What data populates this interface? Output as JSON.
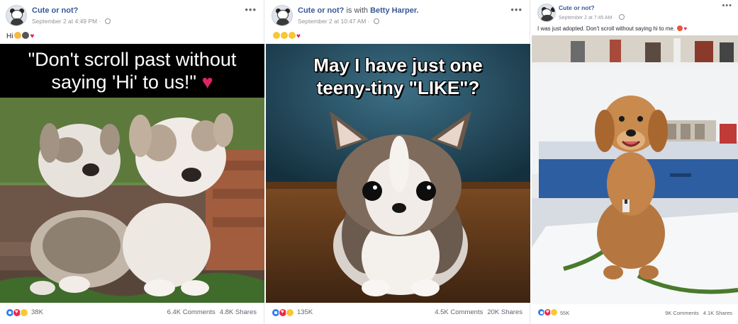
{
  "posts": [
    {
      "page_name": "Cute or not?",
      "with_text": "",
      "with_person": "",
      "timestamp": "September 2 at 4:49 PM",
      "caption": "Hi",
      "image_text_line1": "\"Don't scroll past without",
      "image_text_line2": "saying 'Hi' to us!\"",
      "reaction_count": "38K",
      "comments": "6.4K Comments",
      "shares": "4.8K Shares"
    },
    {
      "page_name": "Cute or not?",
      "with_text": " is with ",
      "with_person": "Betty Harper.",
      "timestamp": "September 2 at 10:47 AM",
      "caption": "",
      "image_text_line1": "May I have just one",
      "image_text_line2": "teeny-tiny \"LIKE\"?",
      "reaction_count": "135K",
      "comments": "4.5K Comments",
      "shares": "20K Shares"
    },
    {
      "page_name": "Cute or not?",
      "with_text": "",
      "with_person": "",
      "timestamp": "September 2 at 7:45 AM",
      "caption": "I was just adopted. Don't scroll without saying hi to me.",
      "image_text_line1": "",
      "image_text_line2": "",
      "reaction_count": "55K",
      "comments": "9K Comments",
      "shares": "4.1K Shares"
    }
  ],
  "icons": [
    "avatar-panda",
    "globe-icon",
    "more-options-icon",
    "like-reaction-icon",
    "love-reaction-icon",
    "haha-reaction-icon",
    "wow-reaction-icon"
  ],
  "colors": {
    "link": "#385898",
    "like": "#2f7cf6",
    "love": "#f0284a",
    "haha": "#f7c737",
    "meta": "#90949c"
  }
}
